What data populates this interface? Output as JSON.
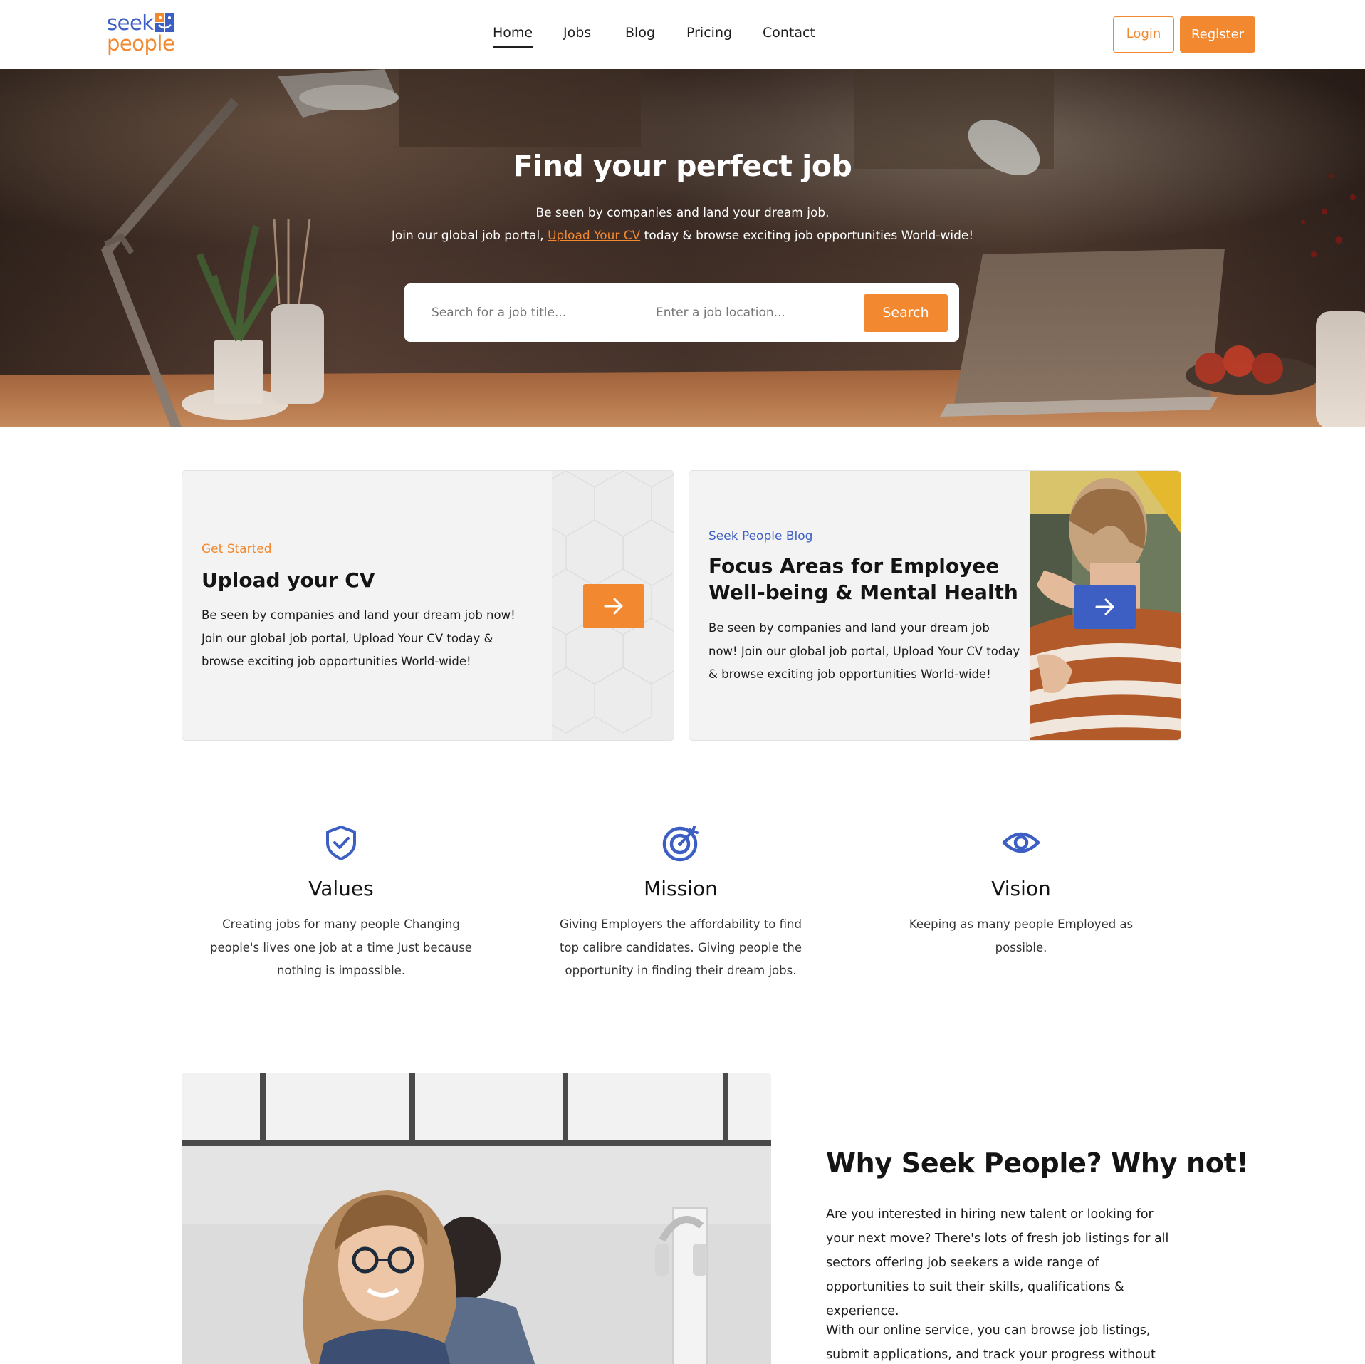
{
  "brand": {
    "line1": "seek",
    "line2": "people",
    "color_primary": "#f28830",
    "color_secondary": "#3d5fc4"
  },
  "nav": {
    "items": [
      {
        "label": "Home",
        "active": true
      },
      {
        "label": "Jobs",
        "active": false
      },
      {
        "label": "Blog",
        "active": false
      },
      {
        "label": "Pricing",
        "active": false
      },
      {
        "label": "Contact",
        "active": false
      }
    ],
    "login_label": "Login",
    "register_label": "Register"
  },
  "hero": {
    "title": "Find your perfect job",
    "line1": "Be seen by companies and land your dream job.",
    "line2_before": "Join our global job portal, ",
    "line2_link": "Upload Your CV",
    "line2_after": " today & browse exciting job opportunities World-wide!",
    "search_title_placeholder": "Search for a job title...",
    "search_location_placeholder": "Enter a job location...",
    "search_button": "Search"
  },
  "cards": [
    {
      "eyebrow": "Get Started",
      "title": "Upload your CV",
      "body": "Be seen by companies and land your dream job now! Join our global job portal, Upload Your CV today & browse exciting job opportunities World-wide!",
      "icon": "arrow-right-icon"
    },
    {
      "eyebrow": "Seek People Blog",
      "title": "Focus Areas for Employee Well-being & Mental Health",
      "body": "Be seen by companies and land your dream job now! Join our global job portal, Upload Your CV today & browse exciting job opportunities World-wide!",
      "icon": "arrow-right-icon"
    }
  ],
  "features": [
    {
      "icon": "shield-check-icon",
      "title": "Values",
      "text": "Creating jobs for many people Changing people's lives one job at a time Just because nothing is impossible."
    },
    {
      "icon": "target-icon",
      "title": "Mission",
      "text": "Giving Employers the affordability to find top calibre candidates. Giving people the opportunity in finding their dream jobs."
    },
    {
      "icon": "eye-icon",
      "title": "Vision",
      "text": "Keeping as many people Employed as possible."
    }
  ],
  "why": {
    "title": "Why Seek People? Why not!",
    "p1": "Are you interested in hiring new talent or looking for your next move? There's lots of fresh job listings for all sectors offering job seekers a wide range of opportunities to suit their skills, qualifications & experience.",
    "p2": "With our online service, you can browse job listings, submit applications, and track your progress without any hassle."
  }
}
